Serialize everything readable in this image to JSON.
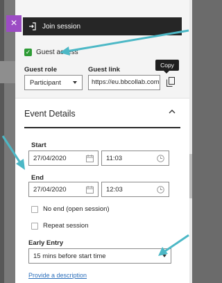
{
  "close": {
    "glyph": "×"
  },
  "join": {
    "label": "Join session"
  },
  "guest": {
    "access_label": "Guest access",
    "role_label": "Guest role",
    "role_value": "Participant",
    "link_label": "Guest link",
    "link_value": "https://eu.bbcollab.com",
    "copy_tooltip": "Copy"
  },
  "event": {
    "title": "Event Details",
    "caret": "^",
    "start_label": "Start",
    "start_date": "27/04/2020",
    "start_time": "11:03",
    "end_label": "End",
    "end_date": "27/04/2020",
    "end_time": "12:03",
    "no_end_label": "No end (open session)",
    "repeat_label": "Repeat session",
    "early_label": "Early Entry",
    "early_value": "15 mins before start time",
    "description_link": "Provide a description"
  },
  "colors": {
    "accent_purple": "#9c4cc4",
    "check_green": "#2e9c36",
    "link_blue": "#2a6ebb",
    "arrow_teal": "#4cb8c6"
  },
  "icons": [
    "close-icon",
    "login-icon",
    "check-icon",
    "chevron-down-icon",
    "copy-icon",
    "chevron-up-icon",
    "calendar-icon",
    "clock-icon"
  ]
}
